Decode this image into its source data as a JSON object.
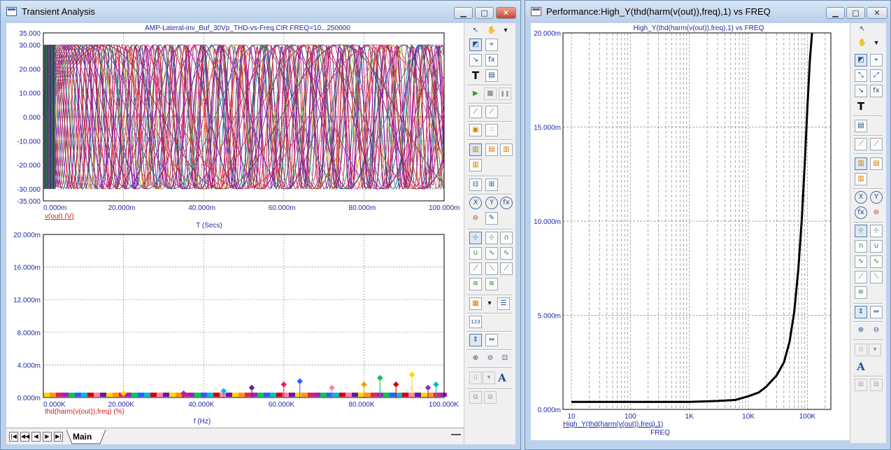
{
  "left_window": {
    "title": "Transient Analysis",
    "minimize_glyph": "▁",
    "maximize_glyph": "□",
    "close_glyph": "✕",
    "upper_plot": {
      "title": "AMP-Lateral-inv_Buf_30Vp_THD-vs-Freq.CIR FREQ=10...250000",
      "y_ticks": [
        "35.000",
        "30.000",
        "20.000",
        "10.000",
        "0.000",
        "-10.000",
        "-20.000",
        "-30.000",
        "-35.000"
      ],
      "x_ticks": [
        "0.000m",
        "20.000m",
        "40.000m",
        "60.000m",
        "80.000m",
        "100.000m"
      ],
      "trace_label": "v(out) (V)",
      "x_label": "T (Secs)"
    },
    "lower_plot": {
      "y_ticks": [
        "20.000m",
        "16.000m",
        "12.000m",
        "8.000m",
        "4.000m",
        "0.000m"
      ],
      "x_ticks": [
        "0.000K",
        "20.000K",
        "40.000K",
        "60.000K",
        "80.000K",
        "100.000K"
      ],
      "trace_label": "thd(harm(v(out)),freq) (%)",
      "x_label": "f (Hz)"
    },
    "tabs": {
      "main_label": "Main"
    },
    "toolbar_glyphs": {
      "text_tool": "T",
      "font_tool": "A",
      "fx": "fx",
      "play": "▶",
      "stop": "■",
      "pause": "❚❚"
    }
  },
  "right_window": {
    "title": "Performance:High_Y(thd(harm(v(out)),freq),1) vs FREQ",
    "minimize_glyph": "▁",
    "maximize_glyph": "□",
    "close_glyph": "✕",
    "plot": {
      "title": "High_Y(thd(harm(v(out)),freq),1) vs FREQ",
      "y_ticks": [
        "20.000m",
        "15.000m",
        "10.000m",
        "5.000m",
        "0.000m"
      ],
      "x_ticks": [
        "10",
        "100",
        "1K",
        "10K",
        "100K"
      ],
      "trace_label": "High_Y(thd(harm(v(out)),freq),1)",
      "x_label": "FREQ"
    },
    "toolbar_glyphs": {
      "text_tool": "T",
      "font_tool": "A",
      "fx": "fx"
    }
  },
  "colors": {
    "axis_text": "#1f2aa8",
    "trace_label": "#cc1f1f",
    "grid": "#8a8a8a",
    "performance_curve": "#000000"
  },
  "chart_data": [
    {
      "type": "line",
      "title": "AMP-Lateral-inv_Buf_30Vp_THD-vs-Freq.CIR FREQ=10...250000",
      "xlabel": "T (Secs)",
      "ylabel": "v(out) (V)",
      "xlim": [
        0,
        0.1
      ],
      "ylim": [
        -35,
        35
      ],
      "grid": true,
      "description_series": "family of sine waves, amplitude 30 V, one per stepped frequency"
    },
    {
      "type": "scatter",
      "xlabel": "f (Hz)",
      "ylabel": "thd(harm(v(out)),freq) (%)",
      "xlim": [
        0,
        100000
      ],
      "ylim": [
        0,
        0.02
      ],
      "grid": true,
      "series": [
        {
          "name": "thd(harm(v(out)),freq) (%)",
          "x": [
            20000,
            35000,
            45000,
            52000,
            60000,
            64000,
            72000,
            80000,
            84000,
            88000,
            92000,
            96000,
            98000
          ],
          "y": [
            0.0005,
            0.0005,
            0.0008,
            0.0012,
            0.0016,
            0.002,
            0.0012,
            0.0016,
            0.0024,
            0.0016,
            0.0028,
            0.0012,
            0.0016
          ]
        }
      ]
    },
    {
      "type": "line",
      "title": "High_Y(thd(harm(v(out)),freq),1) vs FREQ",
      "xlabel": "FREQ",
      "ylabel": "High_Y(thd(harm(v(out)),freq),1)",
      "xscale": "log",
      "xlim": [
        10,
        250000
      ],
      "ylim": [
        0,
        0.02
      ],
      "grid": true,
      "series": [
        {
          "name": "High_Y(thd(harm(v(out)),freq),1)",
          "x": [
            10,
            100,
            1000,
            3000,
            6000,
            10000,
            15000,
            20000,
            30000,
            40000,
            50000,
            60000,
            70000,
            80000,
            90000,
            100000,
            110000,
            120000
          ],
          "y": [
            0.0004,
            0.0004,
            0.0004,
            0.00045,
            0.0005,
            0.0007,
            0.0009,
            0.0012,
            0.0018,
            0.0025,
            0.0036,
            0.0052,
            0.0074,
            0.01,
            0.013,
            0.016,
            0.0185,
            0.02
          ]
        }
      ]
    }
  ]
}
